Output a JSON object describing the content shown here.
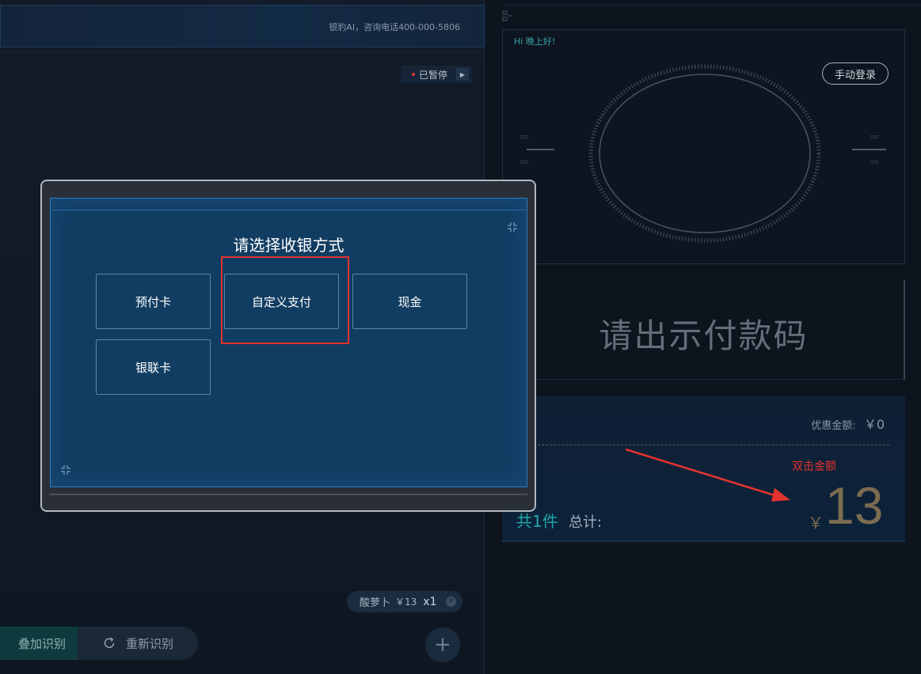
{
  "header": {
    "info_text": "银豹AI，咨询电话400-000-5806"
  },
  "camera": {
    "status_label": "已暂停",
    "status_color": "#e13b3b"
  },
  "recognized_items": [
    {
      "name": "酸萝卜",
      "price": "￥13",
      "qty": "x1"
    }
  ],
  "actions": {
    "stack_label": "叠加识别",
    "rerecognize_label": "重新识别",
    "add_label": "+"
  },
  "face_login": {
    "greeting": "Hi 晚上好!",
    "manual_login_label": "手动登录"
  },
  "payment_code": {
    "prompt": "请出示付款码"
  },
  "totals": {
    "discount_label": "优惠金额:",
    "discount_value": "￥0",
    "count_text": "共1件",
    "total_label": "总计:",
    "currency": "￥",
    "amount": "13"
  },
  "annotation": {
    "tip": "双击金额",
    "color": "#e4332f"
  },
  "dialog": {
    "title": "请选择收银方式",
    "options": [
      "预付卡",
      "自定义支付",
      "现金",
      "银联卡"
    ],
    "highlighted_option": "自定义支付"
  }
}
